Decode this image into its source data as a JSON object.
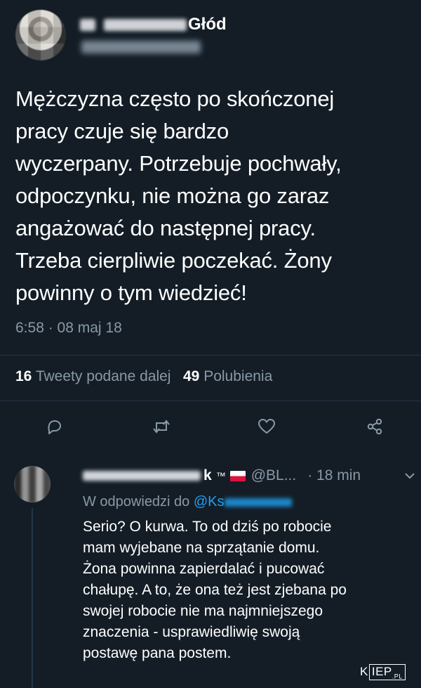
{
  "main_tweet": {
    "author_name_visible": "Głód",
    "text_lines": [
      "Mężczyzna często po skończonej",
      "pracy czuje się bardzo",
      "wyczerpany. Potrzebuje pochwały,",
      "odpoczynku, nie można go zaraz",
      "angażować do następnej pracy.",
      "Trzeba cierpliwie poczekać. Żony",
      "powinny o tym wiedzieć!"
    ],
    "timestamp": "6:58 · 08 maj 18",
    "retweets_count": "16",
    "retweets_label": "Tweety podane dalej",
    "likes_count": "49",
    "likes_label": "Polubienia",
    "actions": {
      "reply_icon": "reply-icon",
      "retweet_icon": "retweet-icon",
      "like_icon": "heart-icon",
      "share_icon": "share-icon"
    }
  },
  "reply_tweet": {
    "name_suffix": "k",
    "trademark": "™",
    "flag": "poland-flag-icon",
    "handle": "@BL...",
    "time": "· 18 min",
    "replying_to_label": "W odpowiedzi do",
    "replying_to_handle_prefix": "@Ks",
    "text_lines": [
      "Serio? O kurwa. To od dziś po robocie",
      "mam wyjebane na sprzątanie domu.",
      "Żona powinna zapierdalać i pucować",
      "chałupę. A to, że ona też jest zjebana po",
      "swojej robocie nie ma najmniejszego",
      "znaczenia - usprawiedliwię swoją",
      "postawę pana postem."
    ]
  },
  "watermark": {
    "prefix": "K",
    "boxed": "IEP",
    "suffix": ".PL"
  },
  "colors": {
    "background": "#141d26",
    "text": "#ffffff",
    "muted": "#8899a6",
    "link": "#1da1f2",
    "separator": "#243447"
  }
}
